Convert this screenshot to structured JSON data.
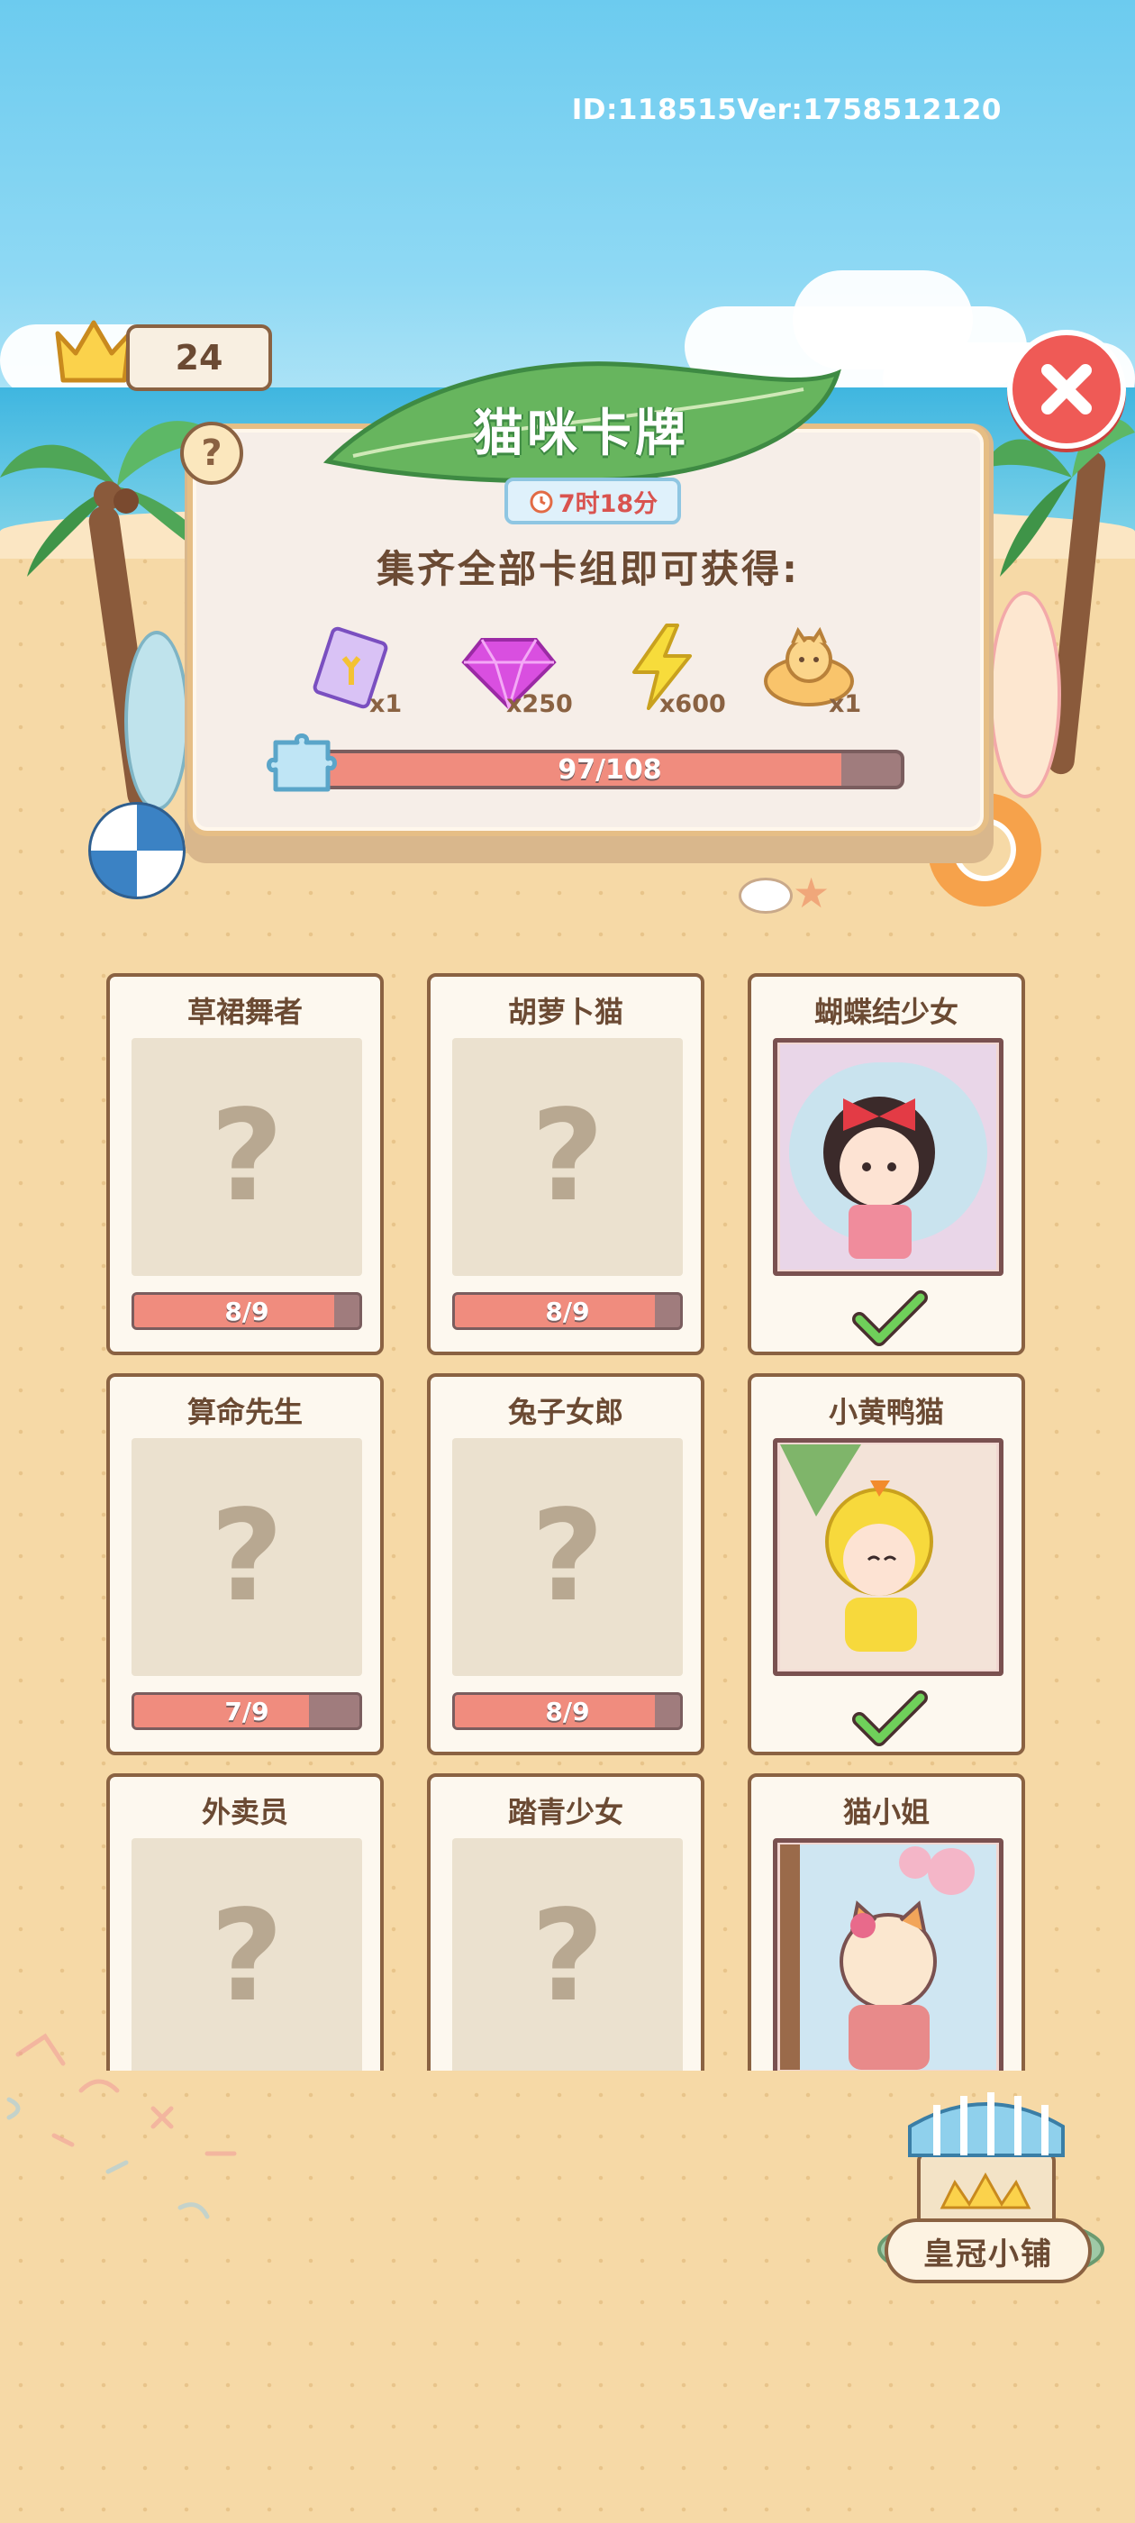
{
  "header": {
    "version_text": "ID:118515Ver:1758512120",
    "crown_count": "24"
  },
  "panel": {
    "title": "猫咪卡牌",
    "timer": "7时18分",
    "subtitle": "集齐全部卡组即可获得:",
    "rewards": [
      {
        "icon": "card-pack-icon",
        "count": "x1"
      },
      {
        "icon": "gem-icon",
        "count": "x250"
      },
      {
        "icon": "lightning-icon",
        "count": "x600"
      },
      {
        "icon": "cat-bed-icon",
        "count": "x1"
      }
    ],
    "progress": {
      "text": "97/108",
      "value": 97,
      "max": 108
    }
  },
  "cards": [
    {
      "title": "草裙舞者",
      "progress": "8/9",
      "value": 8,
      "max": 9,
      "collected": false
    },
    {
      "title": "胡萝卜猫",
      "progress": "8/9",
      "value": 8,
      "max": 9,
      "collected": false
    },
    {
      "title": "蝴蝶结少女",
      "collected": true
    },
    {
      "title": "算命先生",
      "progress": "7/9",
      "value": 7,
      "max": 9,
      "collected": false
    },
    {
      "title": "兔子女郎",
      "progress": "8/9",
      "value": 8,
      "max": 9,
      "collected": false
    },
    {
      "title": "小黄鸭猫",
      "collected": true
    },
    {
      "title": "外卖员",
      "collected": false
    },
    {
      "title": "踏青少女",
      "collected": false
    },
    {
      "title": "猫小姐",
      "collected": true
    }
  ],
  "shop": {
    "label": "皇冠小铺"
  },
  "colors": {
    "accent_red": "#ef5a56",
    "progress_fill": "#f08c7e",
    "leaf_green": "#67b55e"
  }
}
